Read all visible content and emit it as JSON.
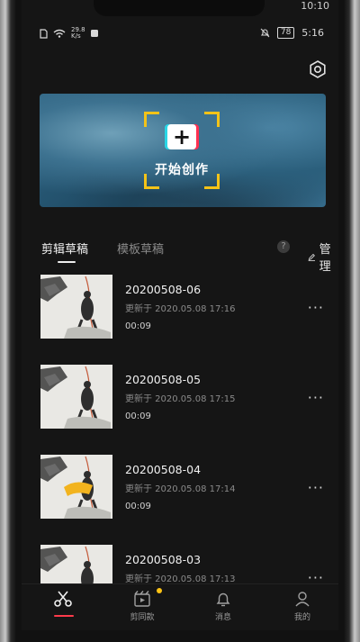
{
  "top_status": {
    "left_text": "",
    "right_time": "10:10"
  },
  "status_bar": {
    "speed_top": "29.8",
    "speed_unit": "K/s",
    "battery": "78",
    "time": "5:16"
  },
  "icons": {
    "settings": "gear-icon",
    "create": "plus-icon",
    "help": "question-icon",
    "manage": "edit-icon",
    "more": "more-dots-icon",
    "nav_edit": "scissors-icon",
    "nav_template": "clapper-icon",
    "nav_messages": "bell-icon",
    "nav_me": "person-icon"
  },
  "banner": {
    "create_label": "开始创作",
    "plus": "+"
  },
  "tabs": [
    {
      "label": "剪辑草稿",
      "active": true
    },
    {
      "label": "模板草稿",
      "active": false
    }
  ],
  "help_label": "?",
  "manage_label": "管理",
  "drafts": [
    {
      "title": "20200508-06",
      "updated": "更新于 2020.05.08 17:16",
      "duration": "00:09",
      "more": "···"
    },
    {
      "title": "20200508-05",
      "updated": "更新于 2020.05.08 17:15",
      "duration": "00:09",
      "more": "···"
    },
    {
      "title": "20200508-04",
      "updated": "更新于 2020.05.08 17:14",
      "duration": "00:09",
      "more": "···"
    },
    {
      "title": "20200508-03",
      "updated": "更新于 2020.05.08 17:13",
      "duration": "",
      "more": "···"
    }
  ],
  "bottom_nav": [
    {
      "label": "",
      "active": true
    },
    {
      "label": "剪同款",
      "active": false,
      "badge_dot": true
    },
    {
      "label": "消息",
      "active": false
    },
    {
      "label": "我的",
      "active": false
    }
  ],
  "colors": {
    "accent_yellow": "#f4c318",
    "active_red": "#ff3b4b",
    "background": "#151515"
  }
}
